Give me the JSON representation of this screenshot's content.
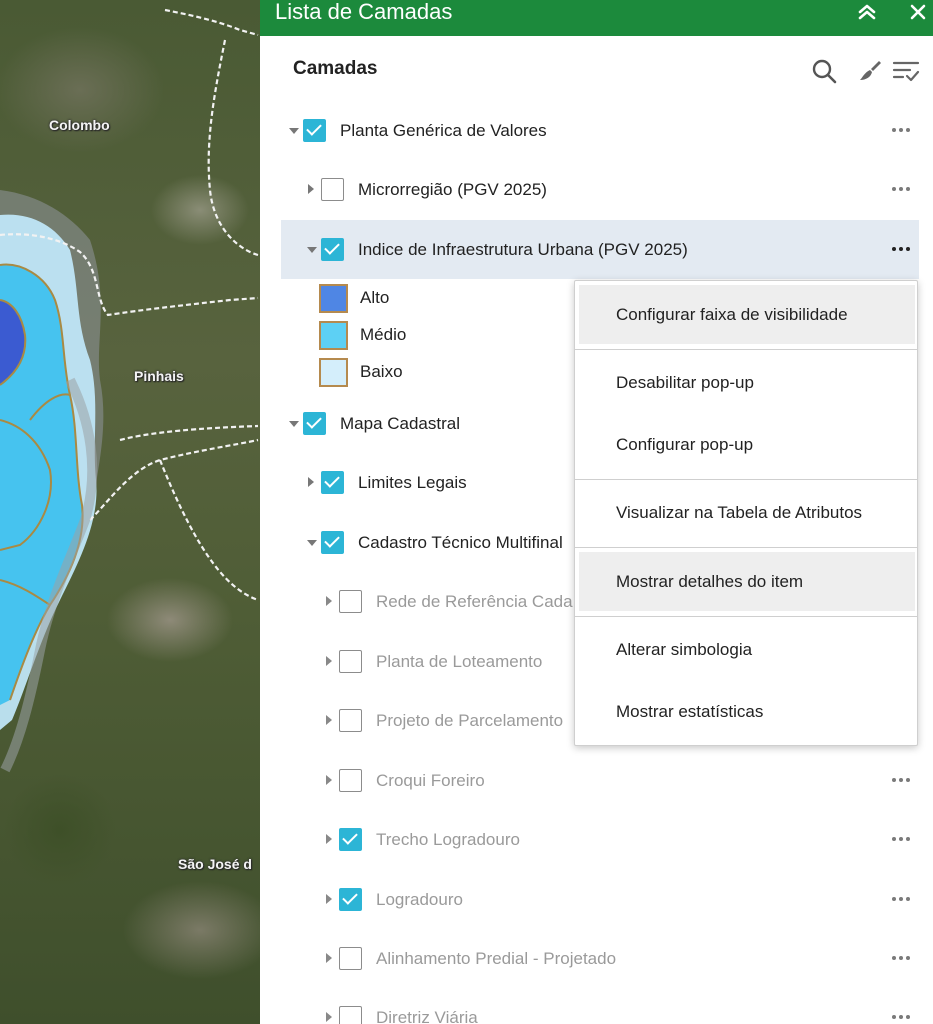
{
  "map": {
    "labels": [
      "Colombo",
      "Pinhais",
      "São José d"
    ],
    "colors": {
      "region_dark": "#3b5bd1",
      "region_mid": "#46c3ef",
      "region_light": "#bfe6f7",
      "region_border": "#a98a43"
    }
  },
  "panel": {
    "title": "Lista de Camadas",
    "header_color": "#1c8a3c",
    "icons": {
      "collapse": "double-chevron-up-icon",
      "close": "close-icon"
    }
  },
  "toolbar": {
    "heading": "Camadas",
    "icons": [
      "search-icon",
      "paintbrush-icon",
      "filter-list-icon"
    ]
  },
  "layers": [
    {
      "label": "Planta Genérica de Valores",
      "checked": true,
      "expanded": true,
      "level": 0,
      "dim": false,
      "menu": true
    },
    {
      "label": "Microrregião (PGV 2025)",
      "checked": false,
      "expanded": false,
      "level": 1,
      "dim": false,
      "menu": true
    },
    {
      "label": "Indice de Infraestrutura Urbana (PGV 2025)",
      "checked": true,
      "expanded": true,
      "level": 1,
      "dim": false,
      "menu": true,
      "selected": true
    },
    {
      "label": "Mapa Cadastral",
      "checked": true,
      "expanded": true,
      "level": 0,
      "dim": false,
      "menu": false
    },
    {
      "label": "Limites Legais",
      "checked": true,
      "expanded": false,
      "level": 1,
      "dim": false,
      "menu": false
    },
    {
      "label": "Cadastro Técnico Multifinal",
      "checked": true,
      "expanded": true,
      "level": 1,
      "dim": false,
      "menu": false
    },
    {
      "label": "Rede de Referência Cada",
      "checked": false,
      "expanded": false,
      "level": 2,
      "dim": true,
      "menu": false
    },
    {
      "label": "Planta de Loteamento",
      "checked": false,
      "expanded": false,
      "level": 2,
      "dim": true,
      "menu": false
    },
    {
      "label": "Projeto de Parcelamento",
      "checked": false,
      "expanded": false,
      "level": 2,
      "dim": true,
      "menu": false
    },
    {
      "label": "Croqui Foreiro",
      "checked": false,
      "expanded": false,
      "level": 2,
      "dim": true,
      "menu": true
    },
    {
      "label": "Trecho Logradouro",
      "checked": true,
      "expanded": false,
      "level": 2,
      "dim": true,
      "menu": true
    },
    {
      "label": "Logradouro",
      "checked": true,
      "expanded": false,
      "level": 2,
      "dim": true,
      "menu": true
    },
    {
      "label": "Alinhamento Predial - Projetado",
      "checked": false,
      "expanded": false,
      "level": 2,
      "dim": true,
      "menu": true
    },
    {
      "label": "Diretriz Viária",
      "checked": false,
      "expanded": false,
      "level": 2,
      "dim": true,
      "menu": true
    }
  ],
  "legend": [
    {
      "label": "Alto",
      "color": "#4f86e4"
    },
    {
      "label": "Médio",
      "color": "#5dd0f4"
    },
    {
      "label": "Baixo",
      "color": "#d4eefb"
    }
  ],
  "context_menu": [
    {
      "label": "Configurar faixa de visibilidade",
      "highlighted": true
    },
    {
      "label": "Desabilitar pop-up",
      "highlighted": false
    },
    {
      "label": "Configurar pop-up",
      "highlighted": false
    },
    {
      "label": "Visualizar na Tabela de Atributos",
      "highlighted": false
    },
    {
      "label": "Mostrar detalhes do item",
      "highlighted": true
    },
    {
      "label": "Alterar simbologia",
      "highlighted": false
    },
    {
      "label": "Mostrar estatísticas",
      "highlighted": false
    }
  ]
}
